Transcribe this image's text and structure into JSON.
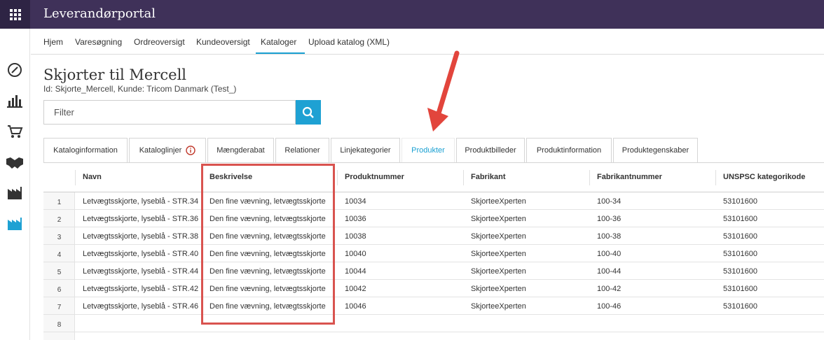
{
  "app": {
    "title": "Leverandørportal"
  },
  "colors": {
    "topbar": "#3f3159",
    "accent": "#1ea1d3",
    "highlight": "#d9534f"
  },
  "nav": {
    "items": [
      {
        "label": "Hjem"
      },
      {
        "label": "Varesøgning"
      },
      {
        "label": "Ordreoversigt"
      },
      {
        "label": "Kundeoversigt"
      },
      {
        "label": "Kataloger"
      },
      {
        "label": "Upload katalog (XML)"
      }
    ],
    "active": "Kataloger"
  },
  "rail": {
    "icons": [
      "dashboard-gauge-icon",
      "bar-chart-icon",
      "shopping-cart-icon",
      "handshake-icon",
      "factory-icon",
      "factory-active-icon"
    ]
  },
  "page": {
    "title": "Skjorter til Mercell",
    "subtitle": "Id: Skjorte_Mercell, Kunde: Tricom Danmark (Test_)"
  },
  "filter": {
    "placeholder": "Filter",
    "value": ""
  },
  "tabs": [
    {
      "label": "Kataloginformation"
    },
    {
      "label": "Kataloglinjer"
    },
    {
      "label": "Mængderabat"
    },
    {
      "label": "Relationer"
    },
    {
      "label": "Linjekategorier"
    },
    {
      "label": "Produkter"
    },
    {
      "label": "Produktbilleder"
    },
    {
      "label": "Produktinformation"
    },
    {
      "label": "Produktegenskaber"
    }
  ],
  "active_tab": "Produkter",
  "table": {
    "columns": [
      "Navn",
      "Beskrivelse",
      "Produktnummer",
      "Fabrikant",
      "Fabrikantnummer",
      "UNSPSC kategorikode"
    ],
    "rows": [
      {
        "n": "1",
        "cells": [
          "Letvægtsskjorte, lyseblå - STR.34",
          "Den fine vævning, letvægtsskjorte",
          "10034",
          "SkjorteeXperten",
          "100-34",
          "53101600"
        ]
      },
      {
        "n": "2",
        "cells": [
          "Letvægtsskjorte, lyseblå - STR.36",
          "Den fine vævning, letvægtsskjorte",
          "10036",
          "SkjorteeXperten",
          "100-36",
          "53101600"
        ]
      },
      {
        "n": "3",
        "cells": [
          "Letvægtsskjorte, lyseblå - STR.38",
          "Den fine vævning, letvægtsskjorte",
          "10038",
          "SkjorteeXperten",
          "100-38",
          "53101600"
        ]
      },
      {
        "n": "4",
        "cells": [
          "Letvægtsskjorte, lyseblå - STR.40",
          "Den fine vævning, letvægtsskjorte",
          "10040",
          "SkjorteeXperten",
          "100-40",
          "53101600"
        ]
      },
      {
        "n": "5",
        "cells": [
          "Letvægtsskjorte, lyseblå - STR.44",
          "Den fine vævning, letvægtsskjorte",
          "10044",
          "SkjorteeXperten",
          "100-44",
          "53101600"
        ]
      },
      {
        "n": "6",
        "cells": [
          "Letvægtsskjorte, lyseblå - STR.42",
          "Den fine vævning, letvægtsskjorte",
          "10042",
          "SkjorteeXperten",
          "100-42",
          "53101600"
        ]
      },
      {
        "n": "7",
        "cells": [
          "Letvægtsskjorte, lyseblå - STR.46",
          "Den fine vævning, letvægtsskjorte",
          "10046",
          "SkjorteeXperten",
          "100-46",
          "53101600"
        ]
      },
      {
        "n": "8",
        "cells": [
          "",
          "",
          "",
          "",
          "",
          ""
        ]
      }
    ]
  }
}
